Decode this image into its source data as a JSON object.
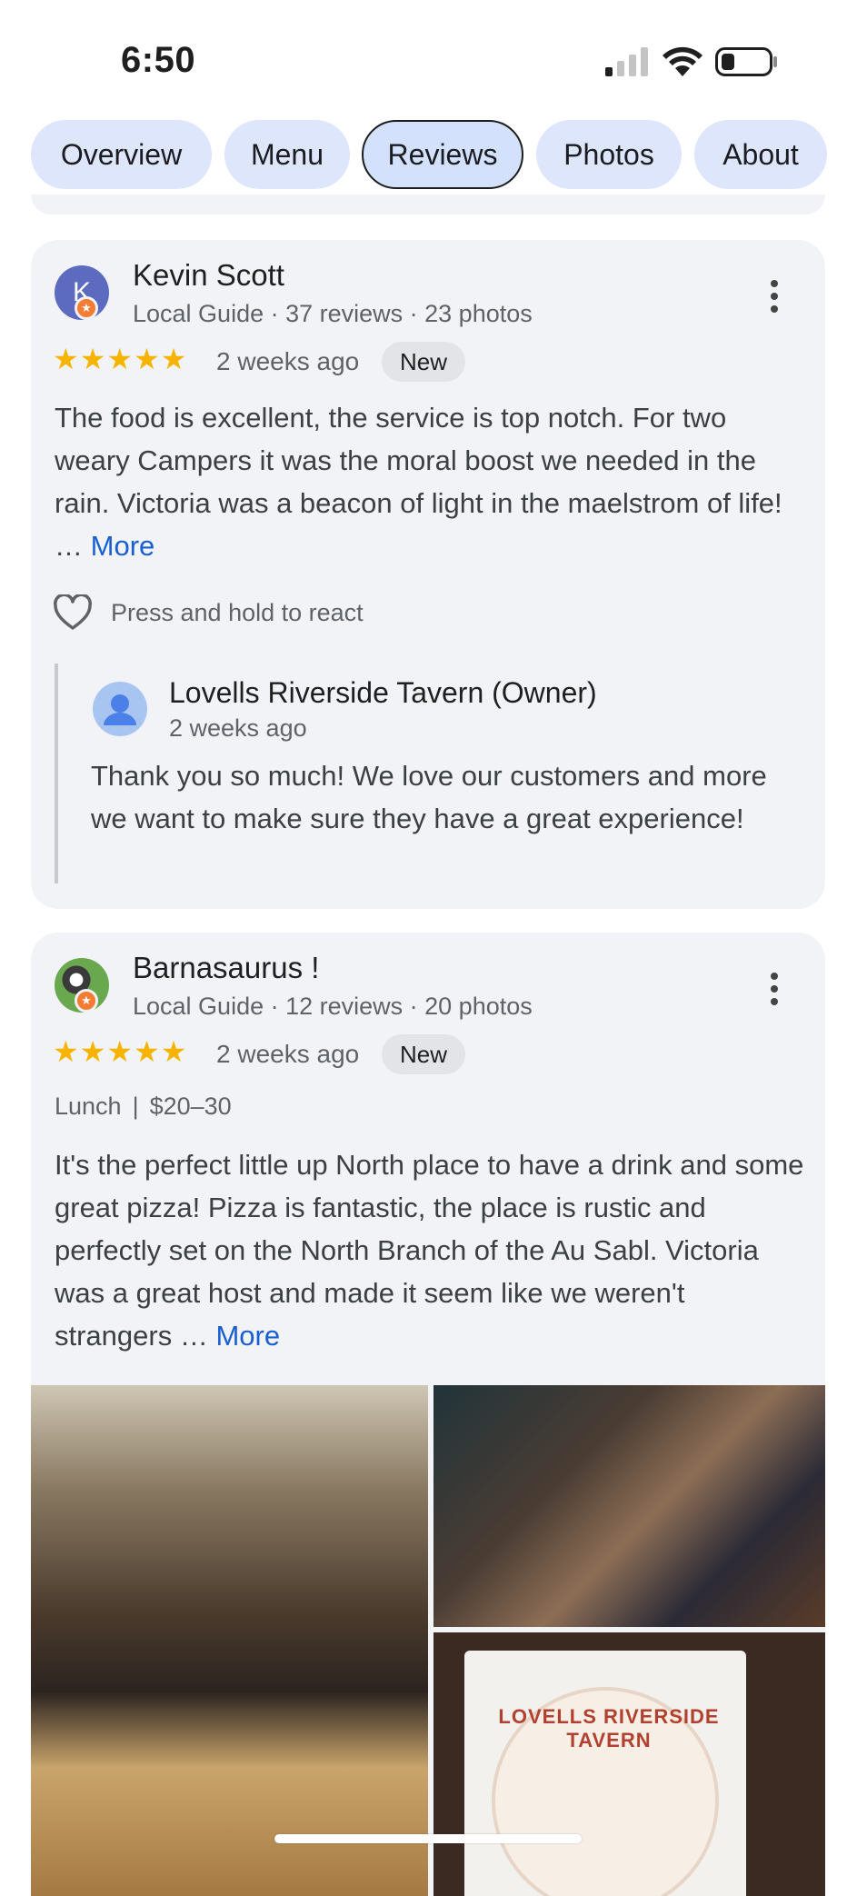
{
  "status_bar": {
    "time": "6:50"
  },
  "tabs": [
    {
      "label": "Overview",
      "active": false
    },
    {
      "label": "Menu",
      "active": false
    },
    {
      "label": "Reviews",
      "active": true
    },
    {
      "label": "Photos",
      "active": false
    },
    {
      "label": "About",
      "active": false
    }
  ],
  "reviews": [
    {
      "avatar_letter": "K",
      "name": "Kevin Scott",
      "meta": "Local Guide · 37 reviews · 23 photos",
      "rating": 5,
      "stars": "★★★★★",
      "time": "2 weeks ago",
      "badge": "New",
      "text": "The food is excellent, the service is top notch. For two weary Campers it was the moral boost we needed in the rain. Victoria was a beacon of light in the maelstrom of life! …",
      "more": "More",
      "react_hint": "Press and hold to react",
      "owner_reply": {
        "name": "Lovells Riverside Tavern (Owner)",
        "time": "2 weeks ago",
        "text": "Thank you so much! We love our customers and more we want to make sure they have a great experience!"
      }
    },
    {
      "name": "Barnasaurus !",
      "meta": "Local Guide · 12 reviews · 20 photos",
      "rating": 5,
      "stars": "★★★★★",
      "time": "2 weeks ago",
      "badge": "New",
      "meal": "Lunch",
      "separator": "|",
      "price": "$20–30",
      "text": "It's the perfect little up North place to have a drink and some great pizza! Pizza is fantastic, the place is rustic and perfectly set on the North Branch of the Au Sabl. Victoria was a great host and made it seem like we weren't strangers …",
      "more": "More",
      "sticker_text": "LOVELLS RIVERSIDE TAVERN"
    }
  ],
  "colors": {
    "star": "#f6b400",
    "link": "#1a5fd0",
    "tab_bg": "#dde6fb",
    "card_bg": "#f1f3f7",
    "guide_badge": "#f57c33"
  }
}
